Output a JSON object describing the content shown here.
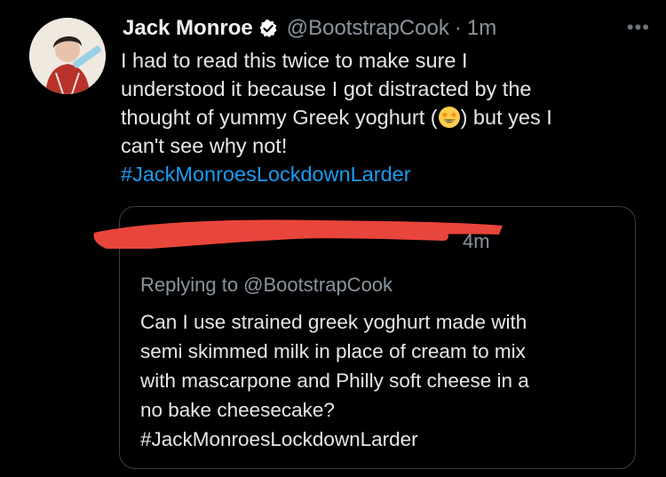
{
  "tweet": {
    "author_name": "Jack Monroe",
    "handle": "@BootstrapCook",
    "separator": "·",
    "time": "1m",
    "more": "•••",
    "text_lines": [
      "I had to read this twice to make sure I",
      "understood it because I got distracted by the",
      "thought of yummy Greek yoghurt (",
      ") but yes I",
      "can't see why not!"
    ],
    "hashtag": "#JackMonroesLockdownLarder",
    "emoji": "star-struck-emoji"
  },
  "quoted_tweet": {
    "time_partial": "4m",
    "replying_to": "Replying to @BootstrapCook",
    "text_lines": [
      "Can I use strained greek yoghurt made with",
      "semi skimmed milk in place of cream to mix",
      "with mascarpone and Philly soft cheese in a",
      "no bake cheesecake?"
    ],
    "hashtag": "#JackMonroesLockdownLarder"
  },
  "colors": {
    "background": "#000000",
    "text": "#e7e7e7",
    "muted": "#8b949e",
    "link": "#1d9bf0",
    "redaction": "#e8453c",
    "border": "#3a3f44"
  }
}
